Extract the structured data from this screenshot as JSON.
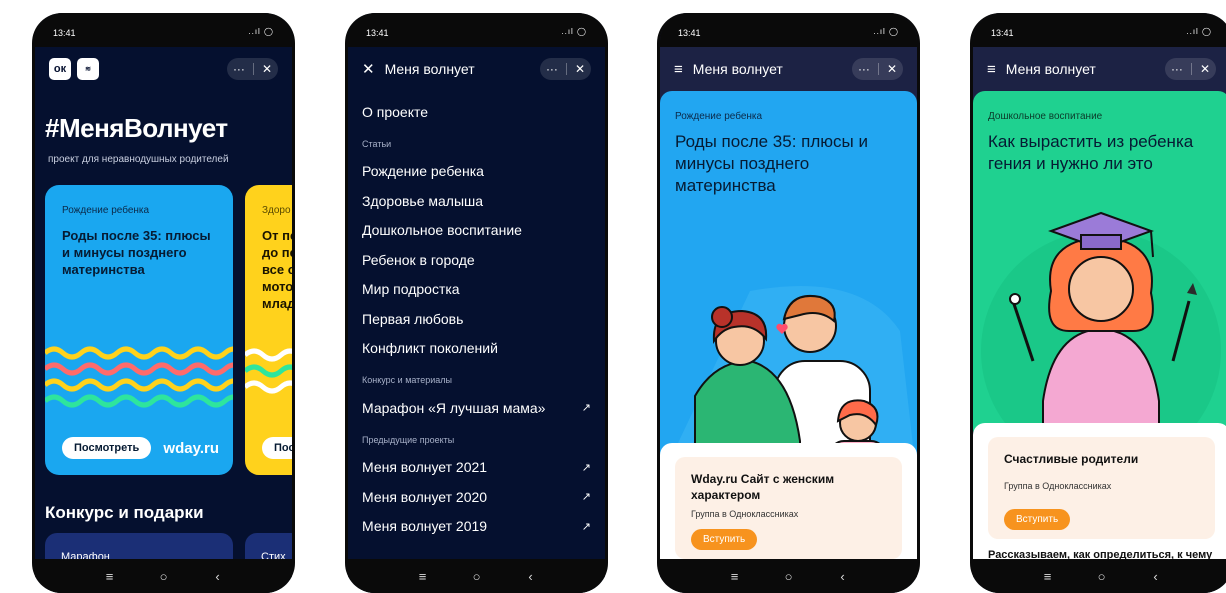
{
  "status": {
    "time": "13:41",
    "icons": "..ıl ◯"
  },
  "nav_icons": {
    "menu": "≡",
    "home": "○",
    "back": "‹"
  },
  "pill": {
    "more": "···",
    "close": "✕"
  },
  "phone1": {
    "hashtag": "#МеняВолнует",
    "subtitle": "проект для неравнодушных родителей",
    "card1": {
      "category": "Рождение ребенка",
      "headline": "Роды после 35: плюсы и минусы позднего материнства",
      "button": "Посмотреть",
      "brand": "wday.ru"
    },
    "card2": {
      "category": "Здоро",
      "headline": "От пе\nдо пе\nвсе о\nмотор\nмладо",
      "button": "Посм"
    },
    "section_title": "Конкурс и подарки",
    "mini1": "Марафон",
    "mini2": "Стих"
  },
  "phone2": {
    "title": "Меня волнует",
    "about": "О проекте",
    "articles_label": "Статьи",
    "articles": [
      "Рождение ребенка",
      "Здоровье малыша",
      "Дошкольное воспитание",
      "Ребенок в городе",
      "Мир подростка",
      "Первая любовь",
      "Конфликт поколений"
    ],
    "contest_label": "Конкурс и материалы",
    "contest_item": "Марафон «Я лучшая мама»",
    "previous_label": "Предыдущие проекты",
    "previous": [
      "Меня волнует 2021",
      "Меня волнует 2020",
      "Меня волнует 2019"
    ],
    "arrow": "↗"
  },
  "phone3": {
    "title": "Меня волнует",
    "category": "Рождение ребенка",
    "headline": "Роды после 35: плюсы и минусы позднего материнства",
    "promo_title": "Wday.ru Сайт с женским характером",
    "promo_sub": "Группа в Одноклассниках",
    "join": "Вступить"
  },
  "phone4": {
    "title": "Меня волнует",
    "category": "Дошкольное воспитание",
    "headline": "Как вырастить из ребенка гения и нужно ли это",
    "promo_title": "Счастливые родители",
    "promo_sub": "Группа в Одноклассниках",
    "join": "Вступить",
    "teaser": "Рассказываем, как определиться, к чему"
  },
  "colors": {
    "navy": "#05102f",
    "blue": "#1aa7f0",
    "yellow": "#ffd21c",
    "green": "#1fd190",
    "orange": "#f7931e"
  }
}
